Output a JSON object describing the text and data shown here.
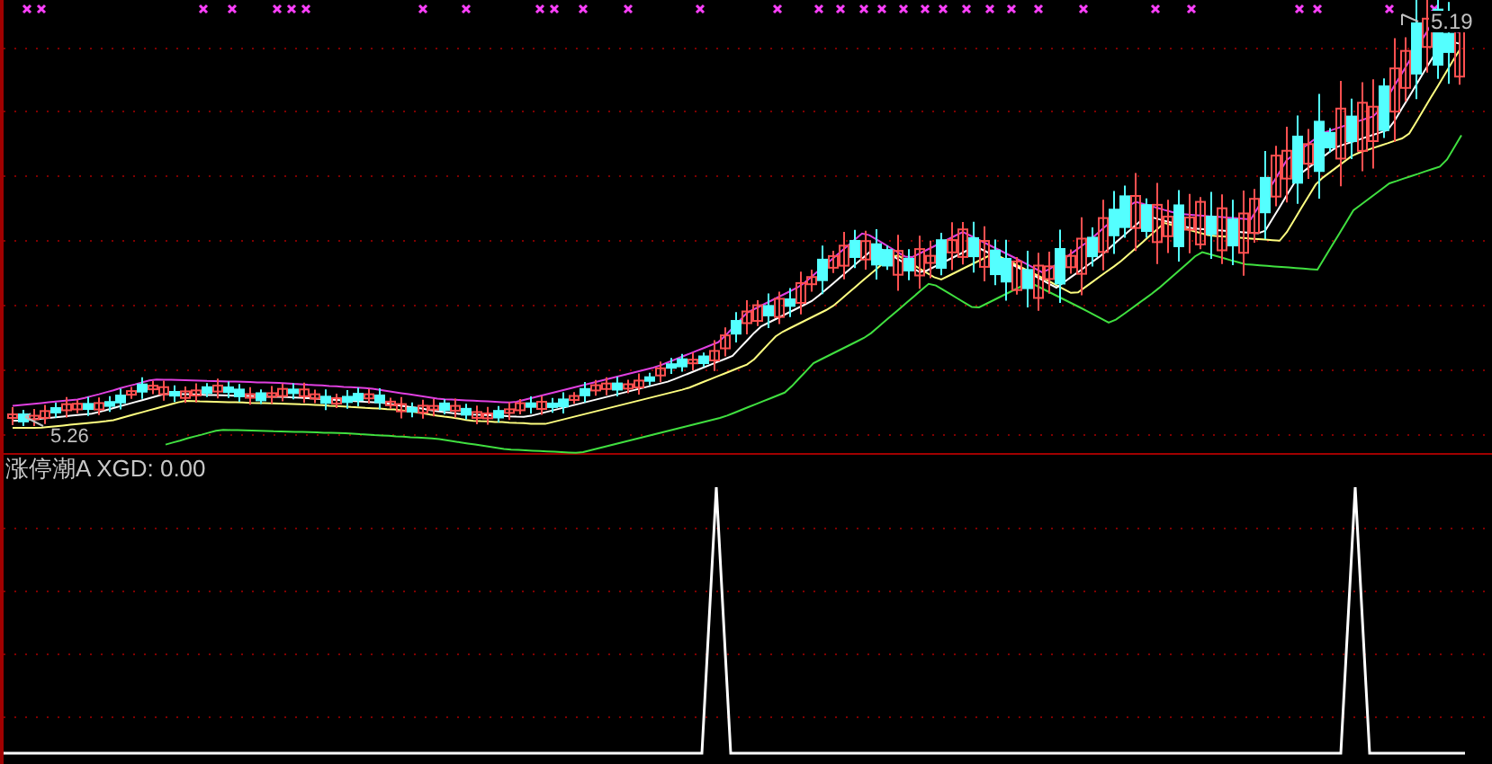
{
  "main_chart": {
    "low_label": "5.26",
    "high_label": "5.19"
  },
  "indicator": {
    "title": "涨停潮A XGD: 0.00"
  }
}
